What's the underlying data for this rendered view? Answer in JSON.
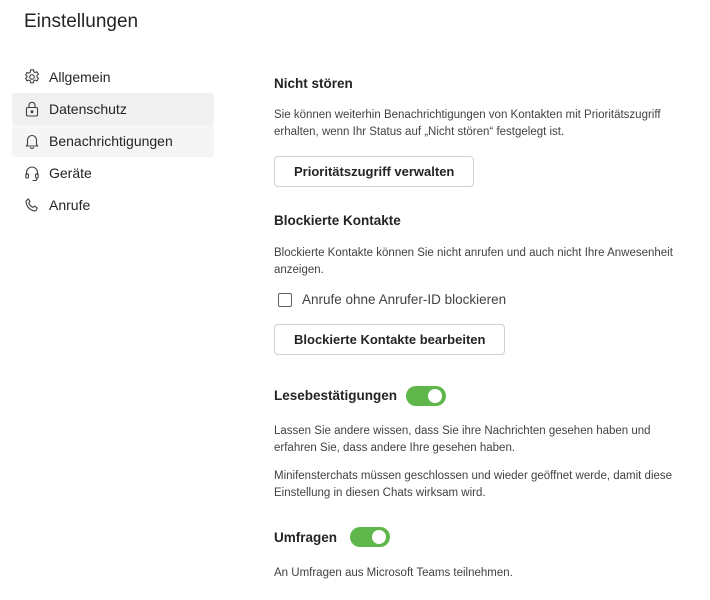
{
  "page_title": "Einstellungen",
  "nav": {
    "items": [
      {
        "label": "Allgemein",
        "icon": "gear-icon"
      },
      {
        "label": "Datenschutz",
        "icon": "lock-icon",
        "selected": true
      },
      {
        "label": "Benachrichtigungen",
        "icon": "bell-icon"
      },
      {
        "label": "Geräte",
        "icon": "headset-icon"
      },
      {
        "label": "Anrufe",
        "icon": "phone-icon"
      }
    ]
  },
  "dnd": {
    "heading": "Nicht stören",
    "description": "Sie können weiterhin Benachrichtigungen von Kontakten mit Prioritätszugriff erhalten, wenn Ihr Status auf „Nicht stören“ festgelegt ist.",
    "button_label": "Prioritätszugriff verwalten"
  },
  "blocked": {
    "heading": "Blockierte Kontakte",
    "description": "Blockierte Kontakte können Sie nicht anrufen und auch nicht Ihre Anwesenheit anzeigen.",
    "checkbox_label": "Anrufe ohne Anrufer-ID blockieren",
    "checkbox_checked": false,
    "button_label": "Blockierte Kontakte bearbeiten"
  },
  "read_receipts": {
    "heading": "Lesebestätigungen",
    "enabled": true,
    "description": "Lassen Sie andere wissen, dass Sie ihre Nachrichten gesehen haben und erfahren Sie, dass andere Ihre gesehen haben.",
    "note": "Minifensterchats müssen geschlossen und wieder geöffnet werde, damit diese Einstellung in diesen Chats wirksam wird."
  },
  "surveys": {
    "heading": "Umfragen",
    "enabled": true,
    "description": "An Umfragen aus Microsoft Teams teilnehmen."
  },
  "colors": {
    "toggle_on": "#5fb74b",
    "nav_selected_bg": "#f0f0f0"
  }
}
